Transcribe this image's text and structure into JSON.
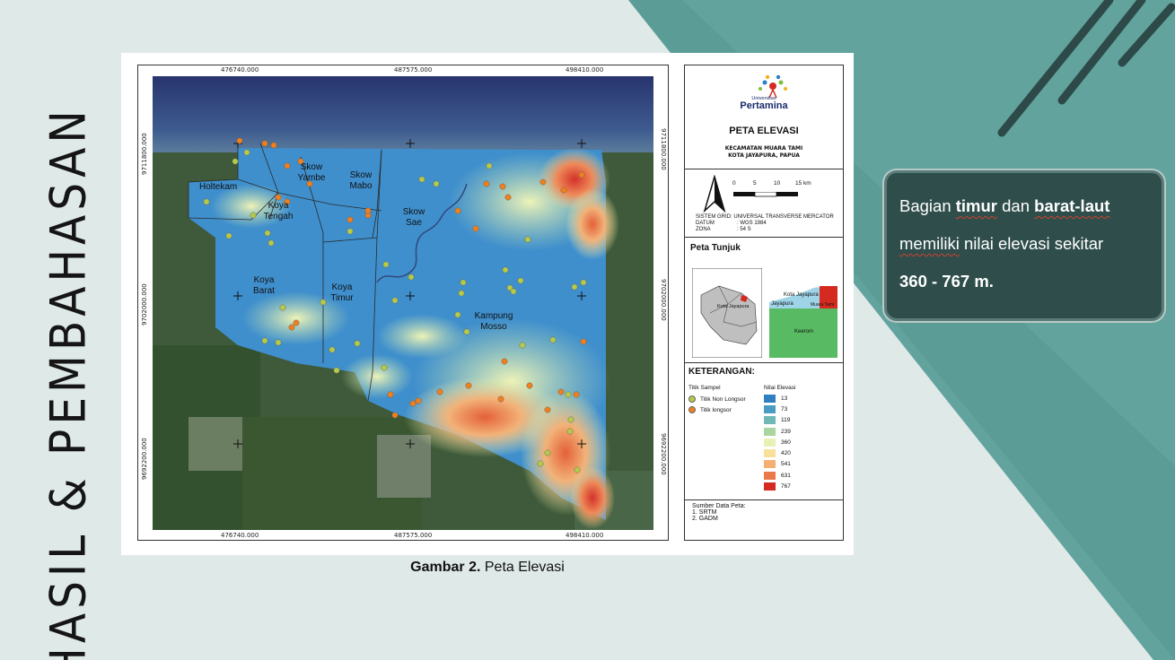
{
  "slide": {
    "side_title": "HASIL & PEMBAHASAN",
    "caption_bold": "Gambar 2.",
    "caption_rest": " Peta Elevasi",
    "callout": {
      "p1": "Bagian ",
      "w_timur": "timur",
      "p2": " dan ",
      "w_barat": "barat-laut",
      "w_memiliki": "memiliki",
      "p3": " nilai elevasi sekitar",
      "value": "360 - 767 m."
    },
    "colors": {
      "accent": "#5f9e9a",
      "callout_bg": "#2f4e4b",
      "bg": "#dfe9e8"
    }
  },
  "map": {
    "coords_top": [
      "476740.000",
      "487575.000",
      "498410.000"
    ],
    "coords_bottom": [
      "476740.000",
      "487575.000",
      "498410.000"
    ],
    "coords_left": [
      "9711800.000",
      "9702000.000",
      "9692200.000"
    ],
    "coords_right": [
      "9711800.000",
      "9702000.000",
      "9692200.000"
    ],
    "districts": [
      {
        "name": "Holtekam"
      },
      {
        "name": "Skow Yambe"
      },
      {
        "name": "Skow Mabo"
      },
      {
        "name": "Koya Tengah"
      },
      {
        "name": "Skow Sae"
      },
      {
        "name": "Koya Barat"
      },
      {
        "name": "Koya Timur"
      },
      {
        "name": "Kampung Mosso"
      }
    ]
  },
  "legend": {
    "logo_small": "Universitas",
    "logo_big": "Pertamina",
    "title": "PETA ELEVASI",
    "subtitle1": "KECAMATAN MUARA TAMI",
    "subtitle2": "KOTA JAYAPURA, PAPUA",
    "scale_labels": [
      "0",
      "5",
      "10",
      "15 km"
    ],
    "grid_line1": "SISTEM GRID: UNIVERSAL TRANSVERSE MERCATOR",
    "grid_datum_k": "DATUM",
    "grid_datum_v": ": WGS 1984",
    "grid_zona_k": "ZONA",
    "grid_zona_v": ": 54 S",
    "tunjuk_head": "Peta Tunjuk",
    "inset1_label": "Kota Jayapura",
    "inset2_labels": [
      "Kota Jayapura",
      "Jayapura",
      "Muara Tami",
      "Keerom"
    ],
    "keterangan_head": "KETERANGAN:",
    "titik_head": "Titik Sampel",
    "titik_items": [
      {
        "label": "Titik Non Longsor",
        "color": "#b5c94a"
      },
      {
        "label": "Titik longsor",
        "color": "#f07f1e"
      }
    ],
    "elev_head": "Nilai Elevasi",
    "elev_items": [
      {
        "label": "13",
        "color": "#2f7fc1"
      },
      {
        "label": "73",
        "color": "#4a9cc4"
      },
      {
        "label": "119",
        "color": "#6fb8b5"
      },
      {
        "label": "239",
        "color": "#a8d5a0"
      },
      {
        "label": "360",
        "color": "#e9f0b5"
      },
      {
        "label": "420",
        "color": "#f6e09a"
      },
      {
        "label": "541",
        "color": "#f4b072"
      },
      {
        "label": "631",
        "color": "#ea7a4a"
      },
      {
        "label": "767",
        "color": "#d42a20"
      }
    ],
    "sumber_head": "Sumber Data Peta:",
    "sumber_items": [
      "1. SRTM",
      "2. GADM"
    ]
  }
}
